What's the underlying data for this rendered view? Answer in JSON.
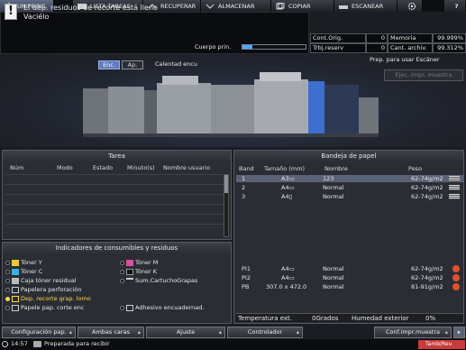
{
  "tabs": [
    {
      "label": "UN.PRINC.",
      "icon": "home-icon",
      "active": true
    },
    {
      "label": "LISTA TAREAS",
      "icon": "job-list-icon"
    },
    {
      "label": "RECUPERAR",
      "icon": "recall-icon"
    },
    {
      "label": "ALMACENAR",
      "icon": "store-icon"
    },
    {
      "label": "COPIAR",
      "icon": "copy-icon"
    },
    {
      "label": "ESCANEAR",
      "icon": "scan-icon"
    }
  ],
  "message": {
    "line1": "El dep. residuos de recorte está lleno",
    "line2": "Vaciélo",
    "icon": "info-icon"
  },
  "toner_meter": {
    "label": "Cuerpo prin.",
    "level": 0.15
  },
  "counters": {
    "row1": {
      "label": "Cont.Orig.",
      "value": "0",
      "label2": "Memoria",
      "value2": "99.999%"
    },
    "row2": {
      "label": "Trbj.reserv",
      "value": "0",
      "label2": "Cant. archiv.",
      "value2": "99.312%"
    }
  },
  "machine": {
    "enc_label": "Enc.",
    "ap_label": "Ap.",
    "heater_label": "Calentad encu",
    "ready_text": "Prep. para usar Escáner",
    "sample_button": "Ejec. impr. muestra"
  },
  "jobs_panel": {
    "title": "Tarea",
    "headers": [
      "Núm",
      "Modo",
      "Estado",
      "Minuto(s)",
      "Nombre usuario"
    ]
  },
  "consumables": {
    "title": "Indicadores de consumibles y residuos",
    "items": [
      {
        "label": "Tóner Y",
        "warn": false
      },
      {
        "label": "Tóner M",
        "warn": false
      },
      {
        "label": "Tóner C",
        "warn": false
      },
      {
        "label": "Tóner K",
        "warn": false
      },
      {
        "label": "Caja tóner residual",
        "warn": false
      },
      {
        "label": "Sum.CartuchoGrapas",
        "warn": false
      },
      {
        "label": "Papelera perforación",
        "warn": false
      },
      {
        "label": "Dep. recorte grap. lomo",
        "warn": true
      },
      {
        "label": "Papele pap. corte enc",
        "warn": false
      },
      {
        "label": "Adhesivo encuadernad.",
        "warn": false
      }
    ]
  },
  "paper_tray": {
    "title": "Bandeja de papel",
    "headers": [
      "Band",
      "Tamaño (mm)",
      "Nombre",
      "Peso"
    ],
    "rows": [
      {
        "tray": "1",
        "size": "A3▭",
        "name": "123",
        "weight": "62-74g/m2",
        "selected": true
      },
      {
        "tray": "2",
        "size": "A4▭",
        "name": "Normal",
        "weight": "62-74g/m2",
        "selected": false
      },
      {
        "tray": "3",
        "size": "A4▯",
        "name": "Normal",
        "weight": "62-74g/m2",
        "selected": false
      },
      {
        "tray": "PI1",
        "size": "A4▭",
        "name": "Normal",
        "weight": "62-74g/m2",
        "selected": false
      },
      {
        "tray": "PI2",
        "size": "A4▭",
        "name": "Normal",
        "weight": "62-74g/m2",
        "selected": false
      },
      {
        "tray": "PB",
        "size": "307.0 x 472.0",
        "name": "Normal",
        "weight": "81-91g/m2",
        "selected": false
      }
    ],
    "temp_label": "Temperatura ext.",
    "temp_value": "0Grados",
    "humidity_label": "Humedad exterior",
    "humidity_value": "0%"
  },
  "footer": {
    "buttons": [
      "Configuración pap.",
      "Ambas caras",
      "Ajuste",
      "Controlador",
      "Conf.impr.muestra"
    ],
    "time": "14:57",
    "status": "Preparada para recibir",
    "tamb_label": "Tamb/Rev."
  },
  "colors": {
    "accent": "#5f7cc0",
    "warn": "#ffd84a",
    "alert": "#c93a3a"
  }
}
